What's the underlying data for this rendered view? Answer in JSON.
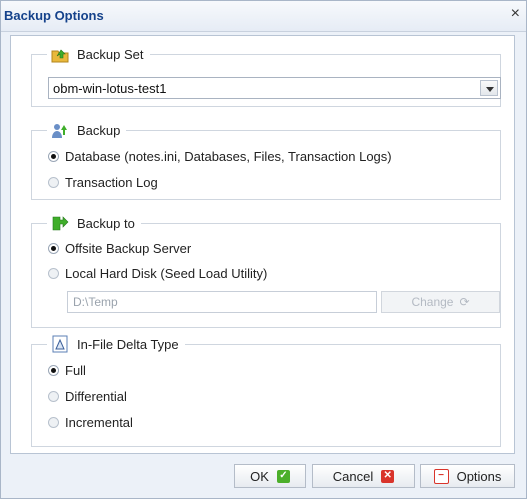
{
  "dialog": {
    "title": "Backup Options",
    "close_glyph": "×"
  },
  "backup_set": {
    "legend": "Backup Set",
    "icon": "folder-up-icon",
    "selected": "obm-win-lotus-test1"
  },
  "backup": {
    "legend": "Backup",
    "icon": "person-upload-icon",
    "options": [
      {
        "label": "Database (notes.ini, Databases, Files, Transaction Logs)",
        "selected": true
      },
      {
        "label": "Transaction Log",
        "selected": false
      }
    ]
  },
  "backup_to": {
    "legend": "Backup to",
    "icon": "green-arrow-icon",
    "options": [
      {
        "label": "Offsite Backup Server",
        "selected": true
      },
      {
        "label": "Local Hard Disk (Seed Load Utility)",
        "selected": false
      }
    ],
    "path_value": "D:\\Temp",
    "change_label": "Change"
  },
  "delta": {
    "legend": "In-File Delta Type",
    "icon": "delta-doc-icon",
    "options": [
      {
        "label": "Full",
        "selected": true
      },
      {
        "label": "Differential",
        "selected": false
      },
      {
        "label": "Incremental",
        "selected": false
      }
    ]
  },
  "buttons": {
    "ok": "OK",
    "cancel": "Cancel",
    "options": "Options"
  },
  "colors": {
    "title": "#15428b",
    "ok_icon": "#4caf2a",
    "cancel_icon": "#d9342b",
    "options_icon": "#d9342b"
  }
}
